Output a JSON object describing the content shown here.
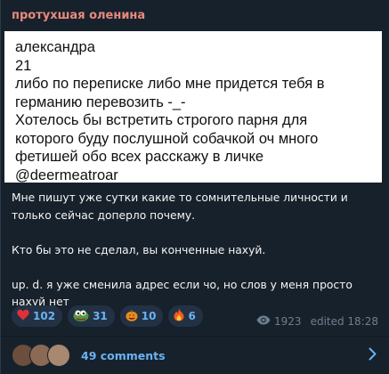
{
  "post": {
    "author": "протухшая оленина",
    "photo_lines": [
      "александра",
      "21",
      "либо по переписке либо мне придется тебя в",
      "германию перевозить -_-",
      "Хотелось бы встретить строгого парня для",
      "которого буду послушной собачкой оч много",
      "фетишей обо всех расскажу в личке",
      "@deermeatroar"
    ],
    "caption": [
      "Мне пишут уже сутки какие то сомнительные личности и только сейчас доперло почему.",
      "Кто бы это не сделал, вы конченные нахуй.",
      "up. d. я уже сменила адрес если чо, но слов у меня просто нахуй нет"
    ],
    "reactions": [
      {
        "emoji": "heart",
        "count": "102"
      },
      {
        "emoji": "pepe",
        "count": "31"
      },
      {
        "emoji": "pumpkin",
        "count": "10"
      },
      {
        "emoji": "fire",
        "count": "6"
      }
    ],
    "views": "1923",
    "edited": "edited 18:28",
    "comments_label": "49 comments"
  },
  "colors": {
    "author": "#e88a7e",
    "accent": "#6ab2f2",
    "background": "#17212b",
    "muted": "#6d7f8f"
  }
}
